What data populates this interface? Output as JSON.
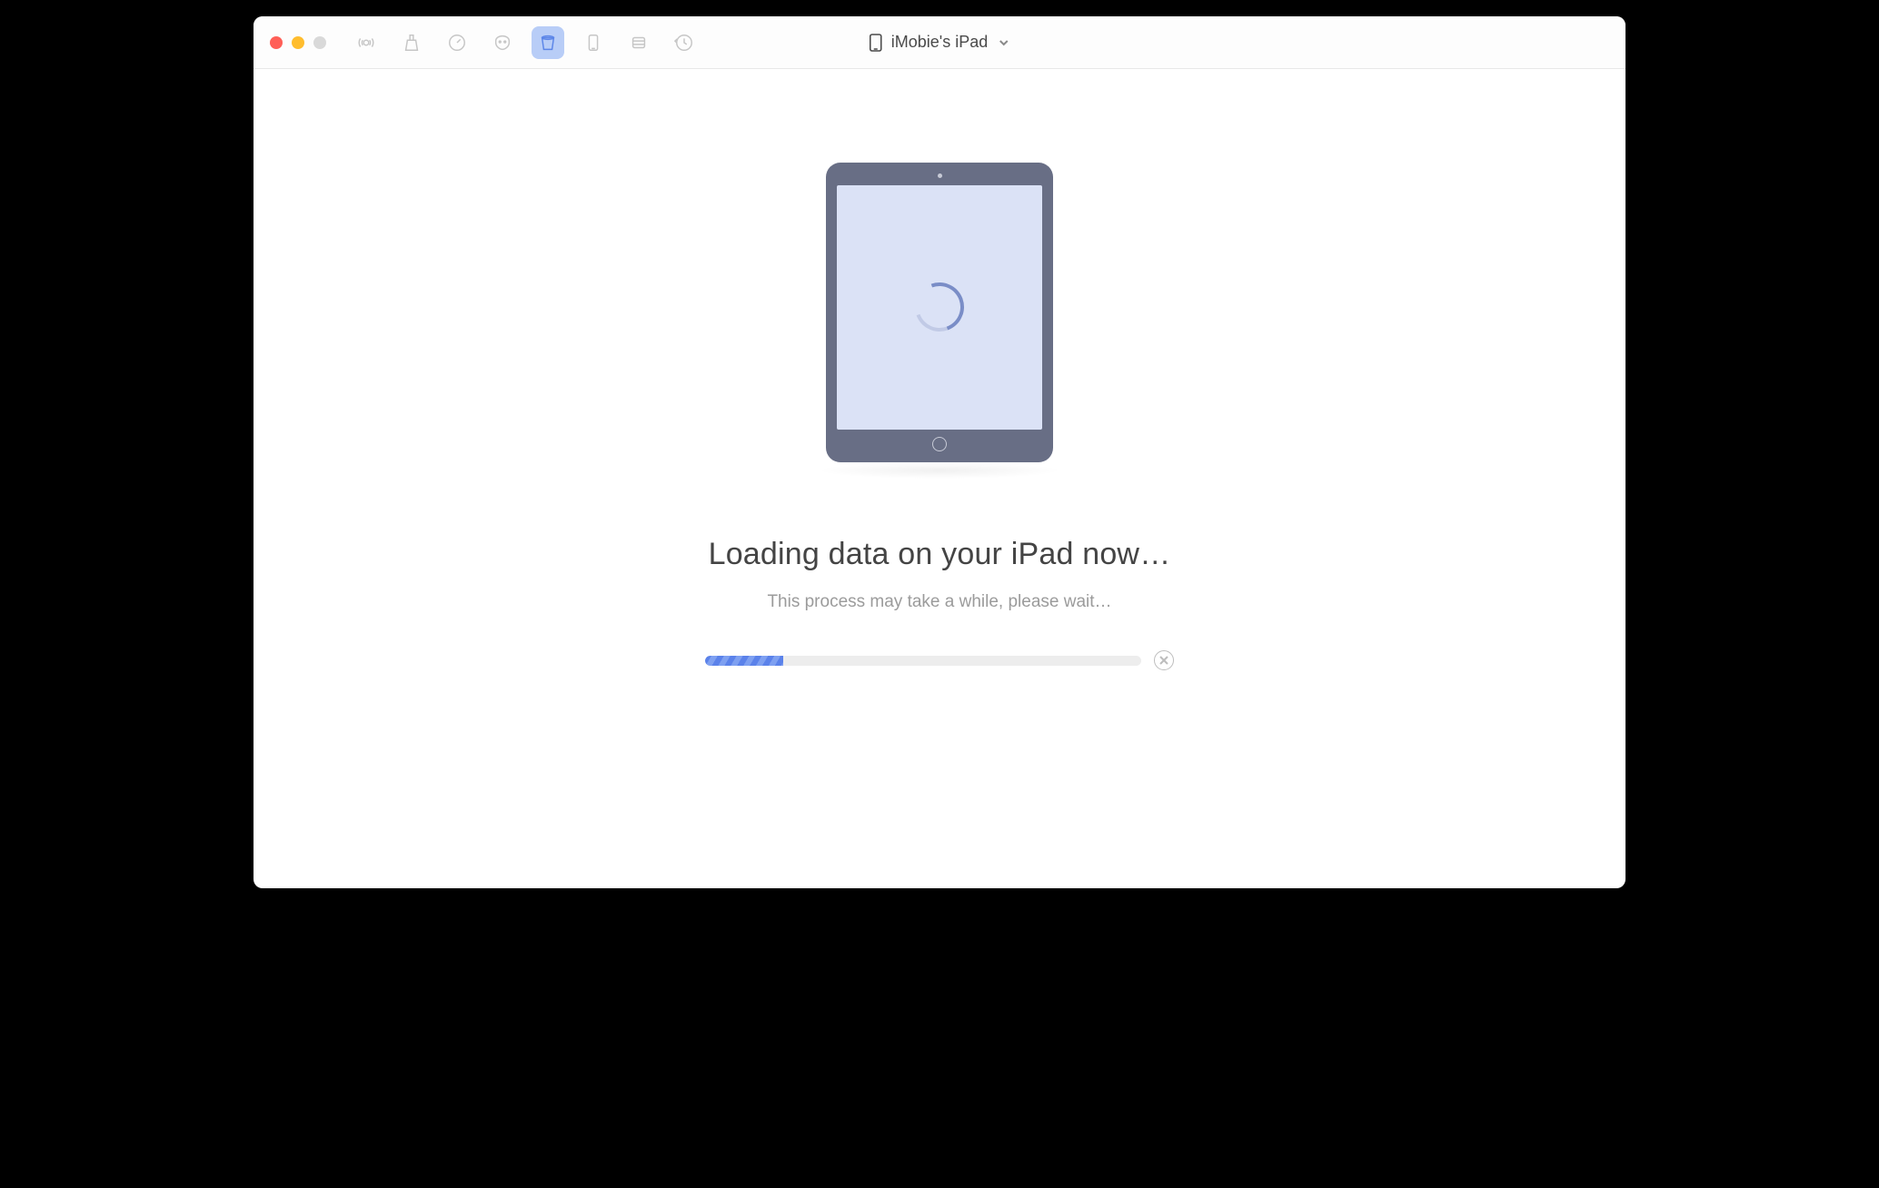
{
  "device": {
    "name": "iMobie's iPad"
  },
  "loading": {
    "title": "Loading data on your iPad now…",
    "subtitle": "This process may take a while, please wait…",
    "progress_percent": 18
  },
  "toolbar": {
    "icons": [
      {
        "name": "airdrop-icon"
      },
      {
        "name": "clean-icon"
      },
      {
        "name": "speed-icon"
      },
      {
        "name": "privacy-icon"
      },
      {
        "name": "bucket-icon",
        "active": true
      },
      {
        "name": "device-icon"
      },
      {
        "name": "apps-icon"
      },
      {
        "name": "history-icon"
      }
    ]
  },
  "colors": {
    "accent": "#5b82ea",
    "toolbar_active_bg": "#b8cdf7",
    "ipad_body": "#686e85",
    "ipad_screen": "#dbe2f6"
  }
}
